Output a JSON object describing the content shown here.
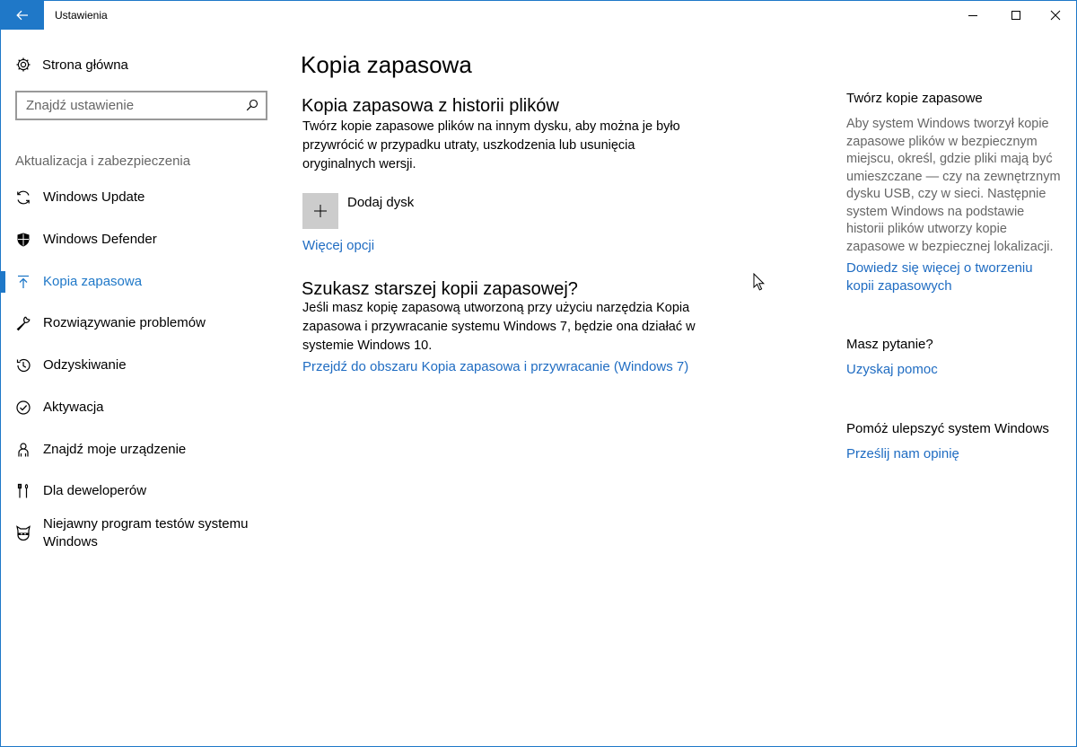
{
  "window": {
    "title": "Ustawienia",
    "accent": "#1f78c8"
  },
  "sidebar": {
    "home_label": "Strona główna",
    "search_placeholder": "Znajdź ustawienie",
    "section_label": "Aktualizacja i zabezpieczenia",
    "items": [
      {
        "label": "Windows Update",
        "icon": "sync-icon"
      },
      {
        "label": "Windows Defender",
        "icon": "shield-icon"
      },
      {
        "label": "Kopia zapasowa",
        "icon": "backup-arrow-icon",
        "active": true
      },
      {
        "label": "Rozwiązywanie problemów",
        "icon": "wrench-icon"
      },
      {
        "label": "Odzyskiwanie",
        "icon": "history-icon"
      },
      {
        "label": "Aktywacja",
        "icon": "check-circle-icon"
      },
      {
        "label": "Znajdź moje urządzenie",
        "icon": "person-icon"
      },
      {
        "label": "Dla deweloperów",
        "icon": "tools-icon"
      },
      {
        "label": "Niejawny program testów systemu Windows",
        "icon": "ninja-cat-icon"
      }
    ]
  },
  "main": {
    "title": "Kopia zapasowa",
    "history_heading": "Kopia zapasowa z historii plików",
    "history_text": "Twórz kopie zapasowe plików na innym dysku, aby można je było przywrócić w przypadku utraty, uszkodzenia lub usunięcia oryginalnych wersji.",
    "add_disk_label": "Dodaj dysk",
    "more_options_link": "Więcej opcji",
    "older_heading": "Szukasz starszej kopii zapasowej?",
    "older_text": "Jeśli masz kopię zapasową utworzoną przy użyciu narzędzia Kopia zapasowa i przywracanie systemu Windows 7, będzie ona działać w systemie Windows 10.",
    "older_link": "Przejdź do obszaru Kopia zapasowa i przywracanie (Windows 7)"
  },
  "right": {
    "backup_title": "Twórz kopie zapasowe",
    "backup_text": "Aby system Windows tworzył kopie zapasowe plików w bezpiecznym miejscu, określ, gdzie pliki mają być umieszczane — czy na zewnętrznym dysku USB, czy w sieci. Następnie system Windows na podstawie historii plików utworzy kopie zapasowe w bezpiecznej lokalizacji.",
    "learn_more_link": "Dowiedz się więcej o tworzeniu kopii zapasowych",
    "question_title": "Masz pytanie?",
    "help_link": "Uzyskaj pomoc",
    "improve_title": "Pomóż ulepszyć system Windows",
    "feedback_link": "Prześlij nam opinię"
  }
}
